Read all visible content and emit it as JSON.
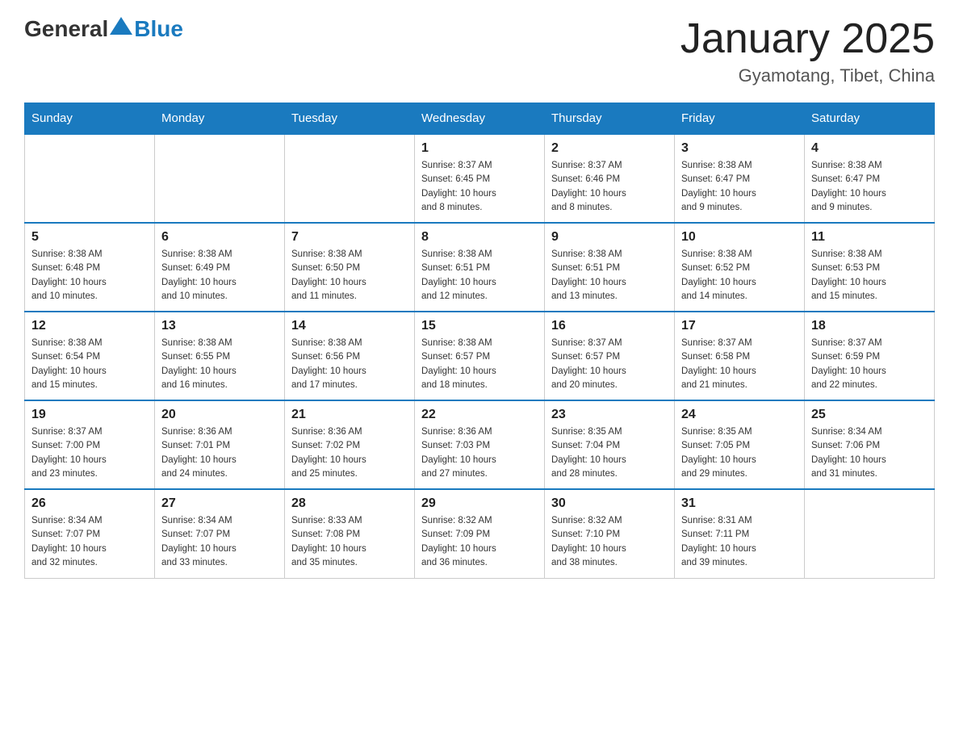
{
  "header": {
    "logo": {
      "text1": "General",
      "text2": "Blue"
    },
    "title": "January 2025",
    "subtitle": "Gyamotang, Tibet, China"
  },
  "days_of_week": [
    "Sunday",
    "Monday",
    "Tuesday",
    "Wednesday",
    "Thursday",
    "Friday",
    "Saturday"
  ],
  "weeks": [
    [
      {
        "day": "",
        "info": ""
      },
      {
        "day": "",
        "info": ""
      },
      {
        "day": "",
        "info": ""
      },
      {
        "day": "1",
        "info": "Sunrise: 8:37 AM\nSunset: 6:45 PM\nDaylight: 10 hours\nand 8 minutes."
      },
      {
        "day": "2",
        "info": "Sunrise: 8:37 AM\nSunset: 6:46 PM\nDaylight: 10 hours\nand 8 minutes."
      },
      {
        "day": "3",
        "info": "Sunrise: 8:38 AM\nSunset: 6:47 PM\nDaylight: 10 hours\nand 9 minutes."
      },
      {
        "day": "4",
        "info": "Sunrise: 8:38 AM\nSunset: 6:47 PM\nDaylight: 10 hours\nand 9 minutes."
      }
    ],
    [
      {
        "day": "5",
        "info": "Sunrise: 8:38 AM\nSunset: 6:48 PM\nDaylight: 10 hours\nand 10 minutes."
      },
      {
        "day": "6",
        "info": "Sunrise: 8:38 AM\nSunset: 6:49 PM\nDaylight: 10 hours\nand 10 minutes."
      },
      {
        "day": "7",
        "info": "Sunrise: 8:38 AM\nSunset: 6:50 PM\nDaylight: 10 hours\nand 11 minutes."
      },
      {
        "day": "8",
        "info": "Sunrise: 8:38 AM\nSunset: 6:51 PM\nDaylight: 10 hours\nand 12 minutes."
      },
      {
        "day": "9",
        "info": "Sunrise: 8:38 AM\nSunset: 6:51 PM\nDaylight: 10 hours\nand 13 minutes."
      },
      {
        "day": "10",
        "info": "Sunrise: 8:38 AM\nSunset: 6:52 PM\nDaylight: 10 hours\nand 14 minutes."
      },
      {
        "day": "11",
        "info": "Sunrise: 8:38 AM\nSunset: 6:53 PM\nDaylight: 10 hours\nand 15 minutes."
      }
    ],
    [
      {
        "day": "12",
        "info": "Sunrise: 8:38 AM\nSunset: 6:54 PM\nDaylight: 10 hours\nand 15 minutes."
      },
      {
        "day": "13",
        "info": "Sunrise: 8:38 AM\nSunset: 6:55 PM\nDaylight: 10 hours\nand 16 minutes."
      },
      {
        "day": "14",
        "info": "Sunrise: 8:38 AM\nSunset: 6:56 PM\nDaylight: 10 hours\nand 17 minutes."
      },
      {
        "day": "15",
        "info": "Sunrise: 8:38 AM\nSunset: 6:57 PM\nDaylight: 10 hours\nand 18 minutes."
      },
      {
        "day": "16",
        "info": "Sunrise: 8:37 AM\nSunset: 6:57 PM\nDaylight: 10 hours\nand 20 minutes."
      },
      {
        "day": "17",
        "info": "Sunrise: 8:37 AM\nSunset: 6:58 PM\nDaylight: 10 hours\nand 21 minutes."
      },
      {
        "day": "18",
        "info": "Sunrise: 8:37 AM\nSunset: 6:59 PM\nDaylight: 10 hours\nand 22 minutes."
      }
    ],
    [
      {
        "day": "19",
        "info": "Sunrise: 8:37 AM\nSunset: 7:00 PM\nDaylight: 10 hours\nand 23 minutes."
      },
      {
        "day": "20",
        "info": "Sunrise: 8:36 AM\nSunset: 7:01 PM\nDaylight: 10 hours\nand 24 minutes."
      },
      {
        "day": "21",
        "info": "Sunrise: 8:36 AM\nSunset: 7:02 PM\nDaylight: 10 hours\nand 25 minutes."
      },
      {
        "day": "22",
        "info": "Sunrise: 8:36 AM\nSunset: 7:03 PM\nDaylight: 10 hours\nand 27 minutes."
      },
      {
        "day": "23",
        "info": "Sunrise: 8:35 AM\nSunset: 7:04 PM\nDaylight: 10 hours\nand 28 minutes."
      },
      {
        "day": "24",
        "info": "Sunrise: 8:35 AM\nSunset: 7:05 PM\nDaylight: 10 hours\nand 29 minutes."
      },
      {
        "day": "25",
        "info": "Sunrise: 8:34 AM\nSunset: 7:06 PM\nDaylight: 10 hours\nand 31 minutes."
      }
    ],
    [
      {
        "day": "26",
        "info": "Sunrise: 8:34 AM\nSunset: 7:07 PM\nDaylight: 10 hours\nand 32 minutes."
      },
      {
        "day": "27",
        "info": "Sunrise: 8:34 AM\nSunset: 7:07 PM\nDaylight: 10 hours\nand 33 minutes."
      },
      {
        "day": "28",
        "info": "Sunrise: 8:33 AM\nSunset: 7:08 PM\nDaylight: 10 hours\nand 35 minutes."
      },
      {
        "day": "29",
        "info": "Sunrise: 8:32 AM\nSunset: 7:09 PM\nDaylight: 10 hours\nand 36 minutes."
      },
      {
        "day": "30",
        "info": "Sunrise: 8:32 AM\nSunset: 7:10 PM\nDaylight: 10 hours\nand 38 minutes."
      },
      {
        "day": "31",
        "info": "Sunrise: 8:31 AM\nSunset: 7:11 PM\nDaylight: 10 hours\nand 39 minutes."
      },
      {
        "day": "",
        "info": ""
      }
    ]
  ]
}
